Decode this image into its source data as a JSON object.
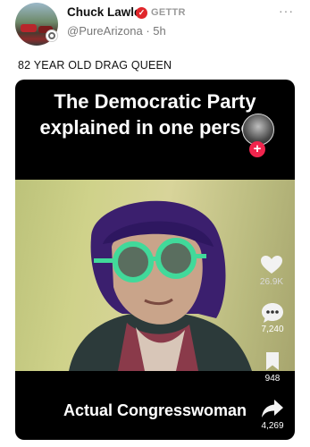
{
  "post": {
    "author_name": "Chuck Lawler",
    "platform_badge": "GETTR",
    "handle_time": "@PureArizona · 5h",
    "more_label": "···",
    "text": "82 YEAR OLD DRAG QUEEN"
  },
  "video": {
    "headline": "The Democratic Party explained in one person.",
    "caption": "Actual Congresswoman",
    "likes": "26.9K",
    "comments": "7,240",
    "saves": "948",
    "shares": "4,269",
    "follow_label": "+"
  },
  "colors": {
    "verified": "#e0262b",
    "follow": "#f0254d"
  }
}
